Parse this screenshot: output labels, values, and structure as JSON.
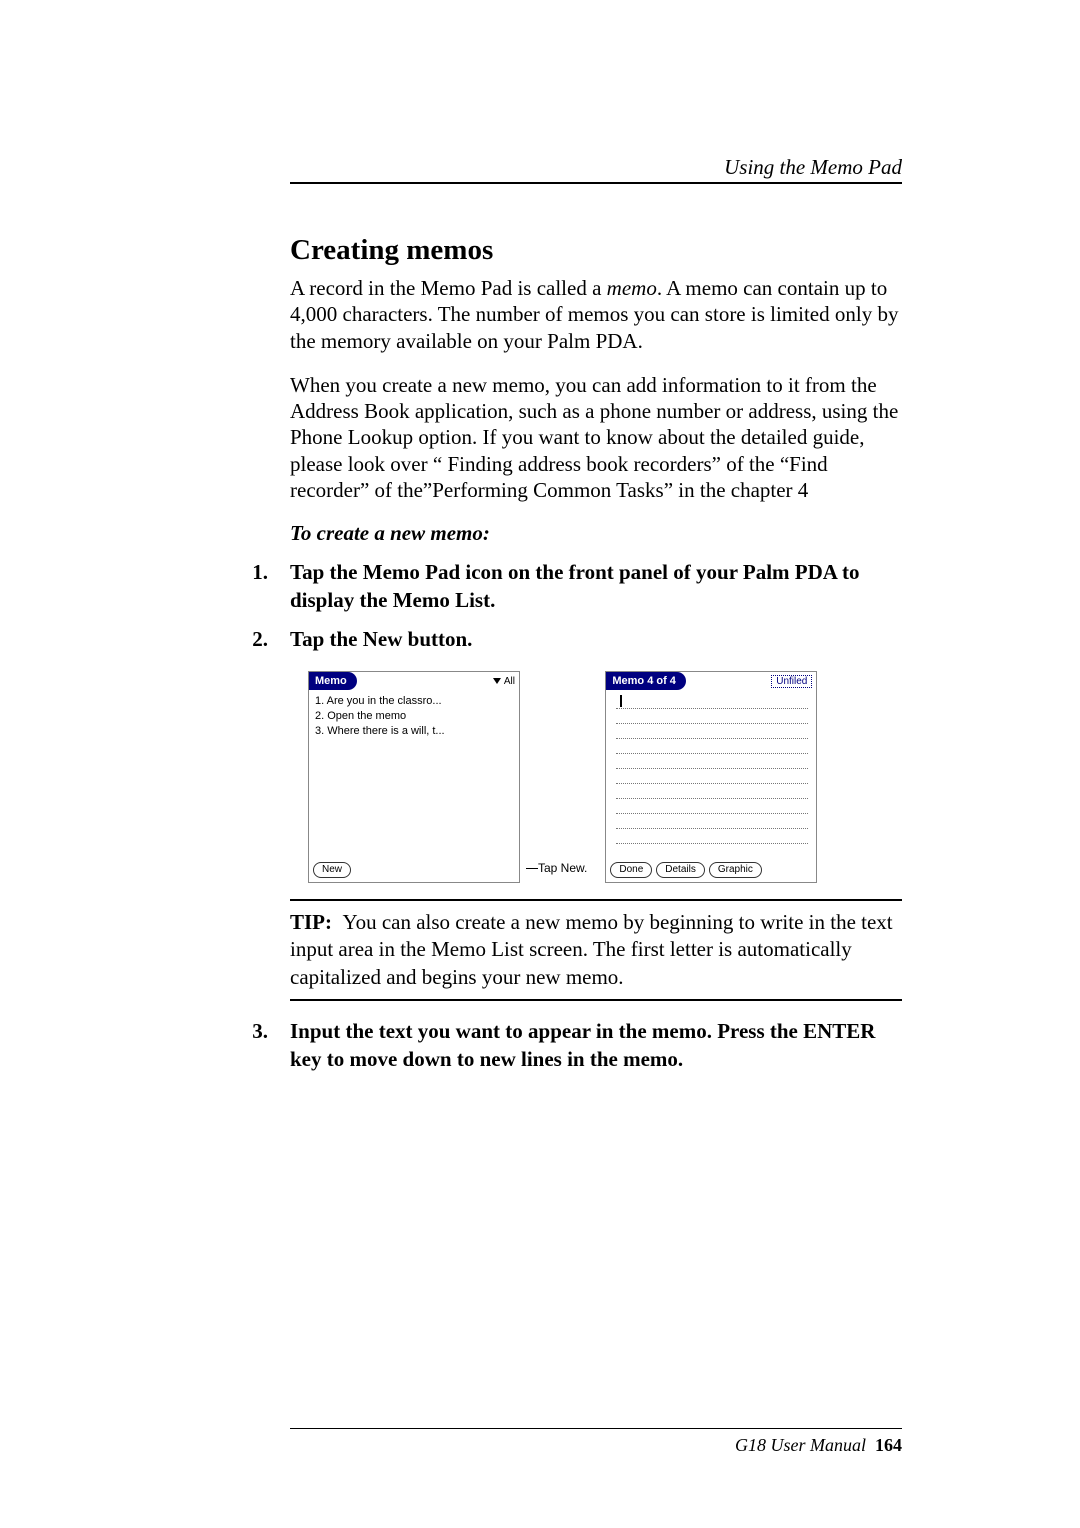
{
  "header": {
    "running": "Using the Memo Pad"
  },
  "title": "Creating memos",
  "para1_a": "A record in the Memo Pad is called a ",
  "para1_memo": "memo",
  "para1_b": ". A memo can contain up to 4,000 characters. The number of memos you can store is limited only by the memory available on your Palm PDA.",
  "para2": "When you create a new memo, you can add information to it from the Address Book application, such as a phone number or address, using the Phone Lookup option. If you want to know about the detailed guide, please look over “ Finding address book recorders” of the “Find recorder” of the”Performing Common Tasks” in the chapter 4",
  "subhead": "To create a new memo:",
  "steps": {
    "s1": {
      "n": "1.",
      "t": "Tap the Memo Pad icon on the front panel of your Palm PDA to display the Memo List."
    },
    "s2": {
      "n": "2.",
      "t": "Tap the New button."
    },
    "s3": {
      "n": "3.",
      "t": "Input the text you want to appear in the memo. Press the ENTER key to move down to new lines in the memo."
    }
  },
  "screens": {
    "left": {
      "title": "Memo",
      "category": "All",
      "items": [
        "1. Are you in the classro...",
        "2. Open the memo",
        "3. Where there is a will, t..."
      ],
      "new_btn": "New"
    },
    "callout": "Tap New.",
    "right": {
      "title": "Memo 4 of 4",
      "category": "Unfiled",
      "done": "Done",
      "details": "Details",
      "graphic": "Graphic"
    }
  },
  "tip": {
    "label": "TIP:",
    "body": "You can also create a new memo by beginning to write in the text input area in the Memo List screen. The first letter is automatically capitalized and begins your new memo."
  },
  "footer": {
    "manual": "G18 User Manual",
    "page": "164"
  }
}
